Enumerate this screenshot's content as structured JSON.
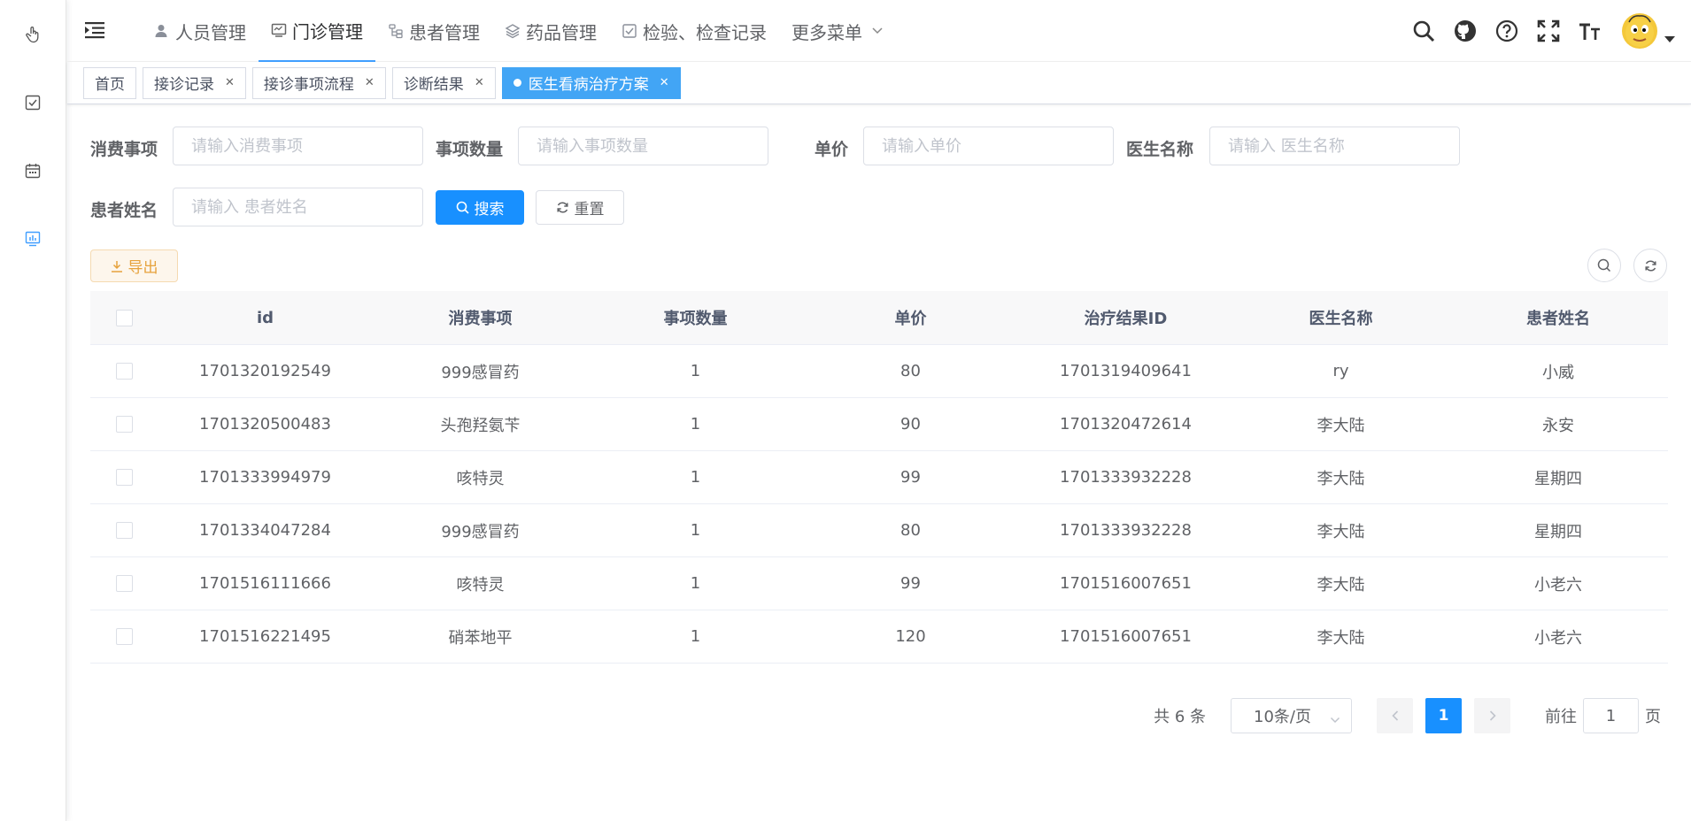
{
  "nav": {
    "menu": [
      {
        "label": "人员管理",
        "icon": "user-icon",
        "active": false
      },
      {
        "label": "门诊管理",
        "icon": "monitor-icon",
        "active": true
      },
      {
        "label": "患者管理",
        "icon": "tree-icon",
        "active": false
      },
      {
        "label": "药品管理",
        "icon": "layers-icon",
        "active": false
      },
      {
        "label": "检验、检查记录",
        "icon": "checkbox-icon",
        "active": false
      },
      {
        "label": "更多菜单",
        "icon": "chevron-down-icon",
        "active": false
      }
    ],
    "tools": [
      "search-icon",
      "github-icon",
      "help-icon",
      "fullscreen-icon",
      "font-size-icon"
    ]
  },
  "sidebar_icons": [
    "hand-pointer-icon",
    "checkbox-icon",
    "calendar-icon",
    "chart-icon"
  ],
  "tags": [
    {
      "label": "首页",
      "closable": false,
      "active": false
    },
    {
      "label": "接诊记录",
      "closable": true,
      "active": false
    },
    {
      "label": "接诊事项流程",
      "closable": true,
      "active": false
    },
    {
      "label": "诊断结果",
      "closable": true,
      "active": false
    },
    {
      "label": "医生看病治疗方案",
      "closable": true,
      "active": true
    }
  ],
  "form": {
    "item_label": "消费事项",
    "item_placeholder": "请输入消费事项",
    "qty_label": "事项数量",
    "qty_placeholder": "请输入事项数量",
    "price_label": "单价",
    "price_placeholder": "请输入单价",
    "doctor_label": "医生名称",
    "doctor_placeholder": "请输入 医生名称",
    "patient_label": "患者姓名",
    "patient_placeholder": "请输入 患者姓名",
    "search_btn": "搜索",
    "reset_btn": "重置"
  },
  "toolbar": {
    "export_btn": "导出"
  },
  "table": {
    "headers": [
      "id",
      "消费事项",
      "事项数量",
      "单价",
      "治疗结果ID",
      "医生名称",
      "患者姓名"
    ],
    "rows": [
      [
        "1701320192549",
        "999感冒药",
        "1",
        "80",
        "1701319409641",
        "ry",
        "小威"
      ],
      [
        "1701320500483",
        "头孢羟氨苄",
        "1",
        "90",
        "1701320472614",
        "李大陆",
        "永安"
      ],
      [
        "1701333994979",
        "咳特灵",
        "1",
        "99",
        "1701333932228",
        "李大陆",
        "星期四"
      ],
      [
        "1701334047284",
        "999感冒药",
        "1",
        "80",
        "1701333932228",
        "李大陆",
        "星期四"
      ],
      [
        "1701516111666",
        "咳特灵",
        "1",
        "99",
        "1701516007651",
        "李大陆",
        "小老六"
      ],
      [
        "1701516221495",
        "硝苯地平",
        "1",
        "120",
        "1701516007651",
        "李大陆",
        "小老六"
      ]
    ]
  },
  "pagination": {
    "total_text": "共 6 条",
    "page_size": "10条/页",
    "current_page": "1",
    "goto_label": "前往",
    "goto_value": "1",
    "page_unit": "页"
  }
}
